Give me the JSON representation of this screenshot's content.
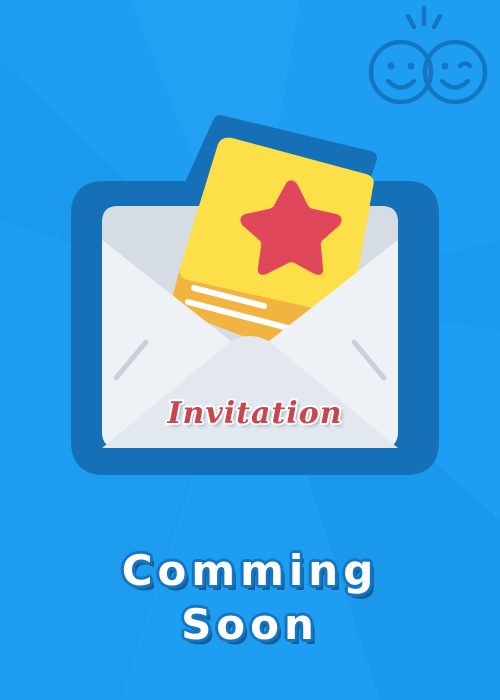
{
  "envelope": {
    "label": "Invitation"
  },
  "status": {
    "line1": "Comming",
    "line2": "Soon"
  },
  "icons": {
    "logo": "two-smiling-faces-icon",
    "envelope": "envelope-icon",
    "card": "invitation-card-icon",
    "star": "star-icon"
  },
  "colors": {
    "background": "#1e9ef2",
    "background_dark": "#1690e3",
    "envelope_outline": "#1670b8",
    "envelope_body": "#e9edf2",
    "card_yellow": "#fde047",
    "card_orange": "#f2b441",
    "star_red": "#e0475a",
    "label_red": "#c9464e",
    "status_text": "#ffffff",
    "status_outline": "#1575c0"
  }
}
